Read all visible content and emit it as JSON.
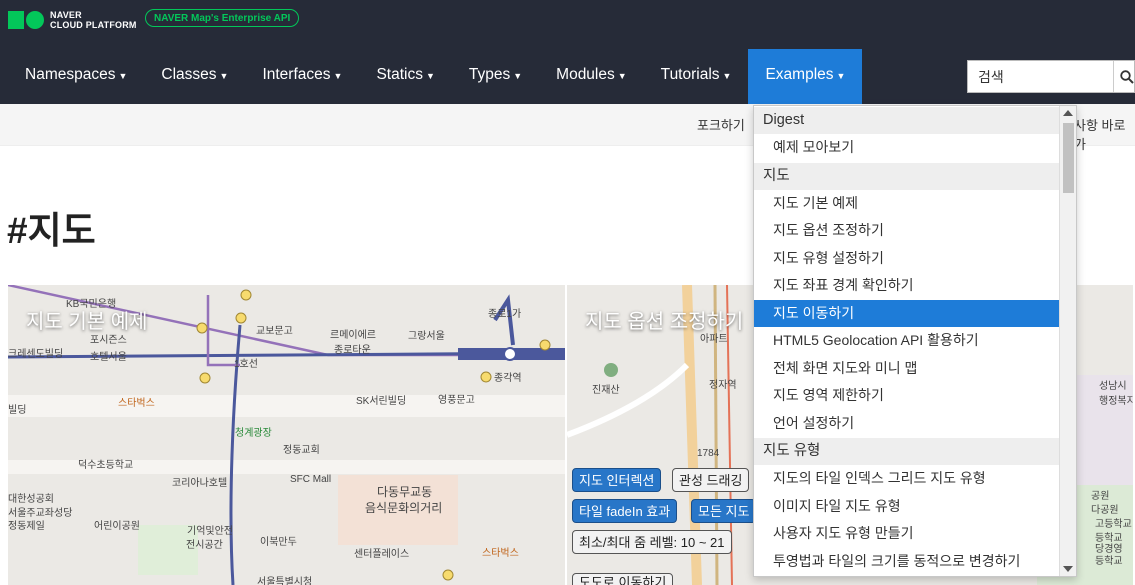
{
  "brand": {
    "line1": "NAVER",
    "line2": "CLOUD PLATFORM",
    "badge": "NAVER Map's Enterprise API",
    "accent": "#03c75a"
  },
  "nav": {
    "items": [
      {
        "label": "Namespaces"
      },
      {
        "label": "Classes"
      },
      {
        "label": "Interfaces"
      },
      {
        "label": "Statics"
      },
      {
        "label": "Types"
      },
      {
        "label": "Modules"
      },
      {
        "label": "Tutorials"
      },
      {
        "label": "Examples",
        "active": true
      }
    ],
    "active_color": "#1e7cd8"
  },
  "search": {
    "placeholder": "검색",
    "icon": "search-icon"
  },
  "subbar": {
    "left_link": "포크하기",
    "right_link": "사항 바로가"
  },
  "page": {
    "heading": "#지도"
  },
  "cards": [
    {
      "title": "지도 기본 예제",
      "labels": [
        "KB국민은행",
        "포시즌스",
        "호텔서울",
        "교보문고",
        "르메이에르",
        "종로타운",
        "그랑서울",
        "종각역",
        "크레센도빌딩",
        "SK서린빌딩",
        "영풍문고",
        "스타벅스",
        "청계광장",
        "빌딩",
        "덕수초등학교",
        "코리아나호텔",
        "SFC Mall",
        "다동무교동",
        "음식문화의거리",
        "대한성공회",
        "서울주교좌성당",
        "정동제일",
        "어린이공원",
        "기억및안전",
        "전시공간",
        "이북만두",
        "센터플레이스",
        "스타벅스",
        "서울특별시청",
        "종로1가",
        "1호선",
        "정동교회"
      ]
    },
    {
      "title": "지도 옵션 조정하기",
      "labels": [
        "아파트",
        "정자역",
        "진재산",
        "1784",
        "성남시",
        "행정복지"
      ],
      "controls": [
        "지도 인터렉션",
        "관성 드래깅",
        "타일 fadeIn 효과",
        "모든 지도",
        "최소/최대 줌 레벨: 10 ~ 21"
      ],
      "next_caption": "도도로 이동하기"
    },
    {
      "labels": [
        "공원",
        "다공원",
        "고등학교",
        "등학교",
        "당경영",
        "등학교"
      ]
    }
  ],
  "dropdown": {
    "groups": [
      {
        "header": "Digest",
        "items": [
          "예제 모아보기"
        ]
      },
      {
        "header": "지도",
        "items": [
          "지도 기본 예제",
          "지도 옵션 조정하기",
          "지도 유형 설정하기",
          "지도 좌표 경계 확인하기",
          "지도 이동하기",
          "HTML5 Geolocation API 활용하기",
          "전체 화면 지도와 미니 맵",
          "지도 영역 제한하기",
          "언어 설정하기"
        ]
      },
      {
        "header": "지도 유형",
        "items": [
          "지도의 타일 인덱스 그리드 지도 유형",
          "이미지 타일 지도 유형",
          "사용자 지도 유형 만들기",
          "투영법과 타일의 크기를 동적으로 변경하기"
        ]
      }
    ],
    "active_item": "지도 이동하기"
  }
}
